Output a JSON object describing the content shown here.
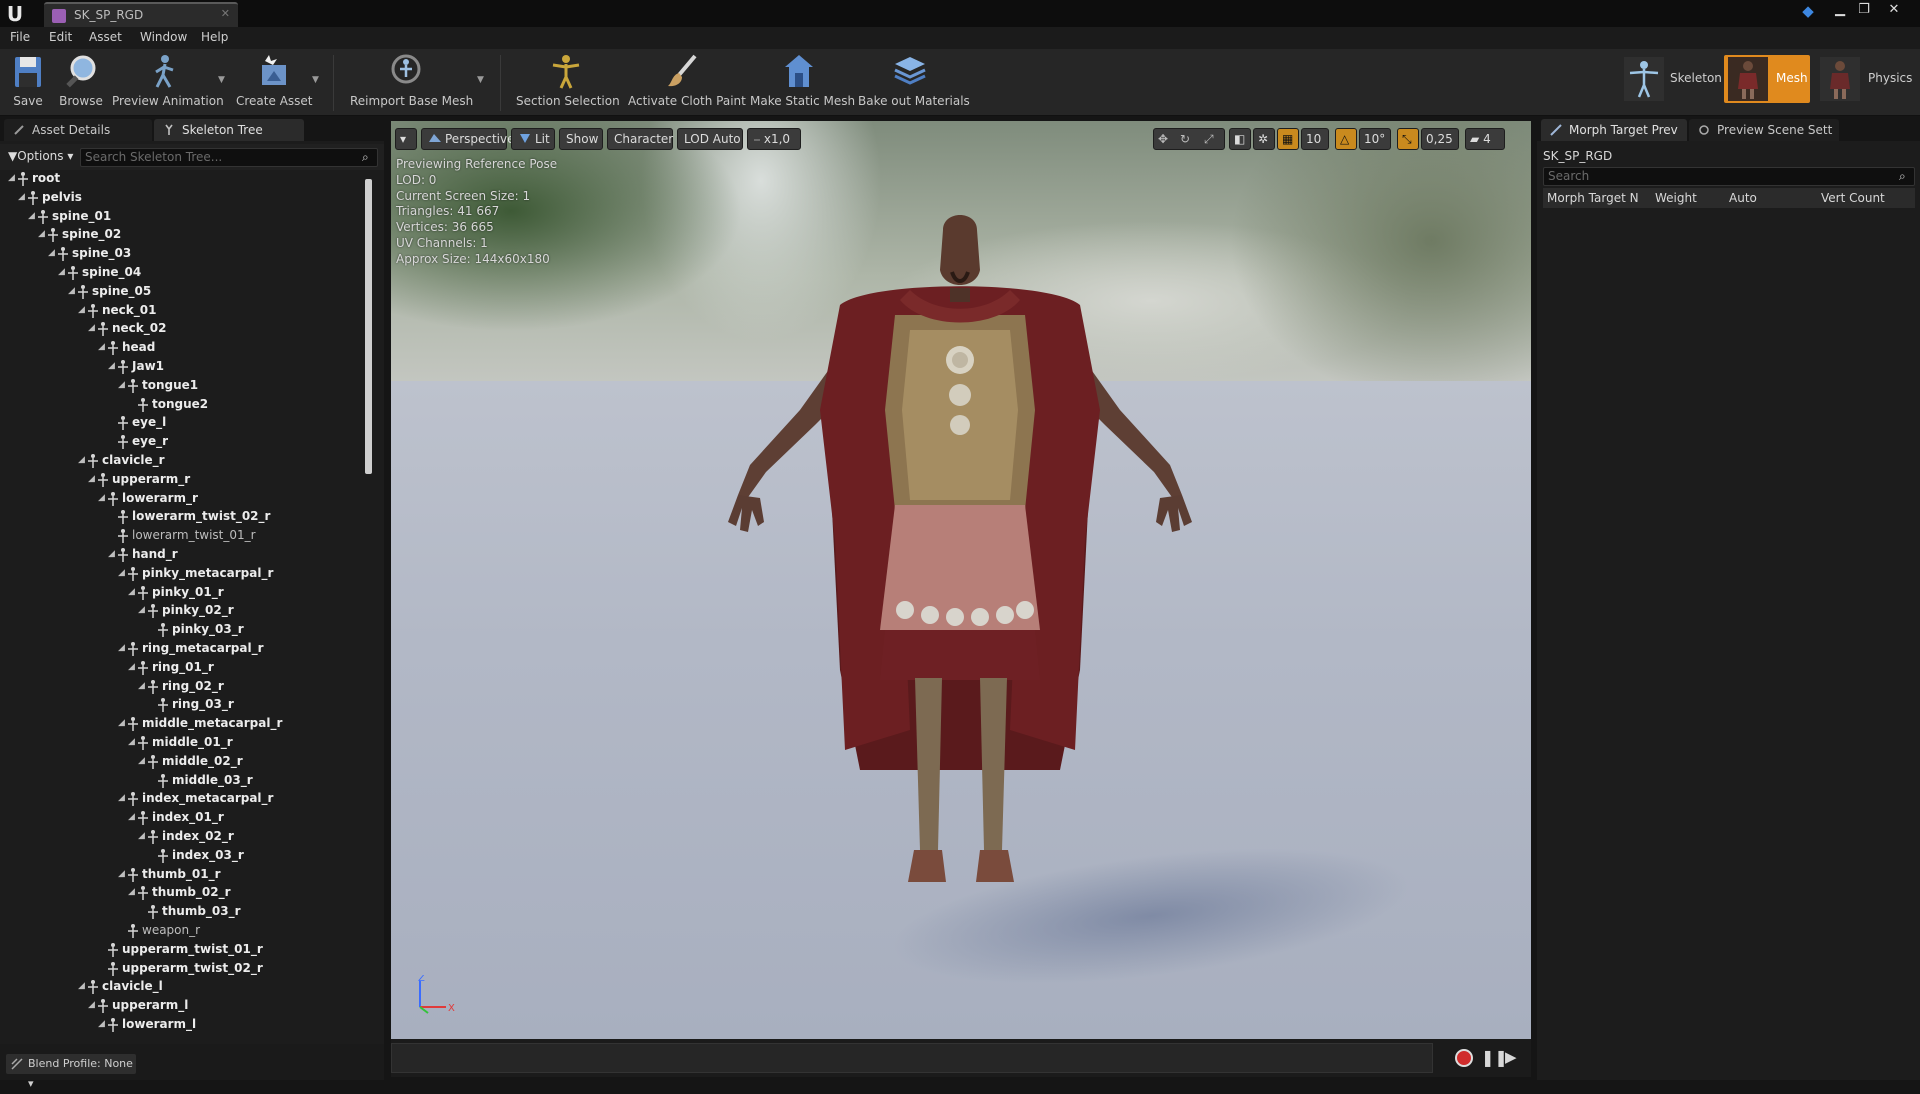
{
  "window": {
    "tab_title": "SK_SP_RGD",
    "controls": {
      "minimize": "▁",
      "restore": "❐",
      "close": "✕"
    }
  },
  "menu": [
    "File",
    "Edit",
    "Asset",
    "Window",
    "Help"
  ],
  "toolbar": {
    "save": "Save",
    "browse": "Browse",
    "preview_animation": "Preview Animation",
    "create_asset": "Create Asset",
    "reimport_base_mesh": "Reimport Base Mesh",
    "section_selection": "Section Selection",
    "activate_cloth_paint": "Activate Cloth Paint",
    "make_static_mesh": "Make Static Mesh",
    "bake_out_materials": "Bake out Materials"
  },
  "modes": {
    "skeleton": "Skeleton",
    "mesh": "Mesh",
    "physics": "Physics",
    "active": "Mesh"
  },
  "left_panel": {
    "tabs": [
      "Asset Details",
      "Skeleton Tree"
    ],
    "options_label": "Options",
    "search_placeholder": "Search Skeleton Tree...",
    "tree": [
      {
        "name": "root",
        "depth": 0,
        "bold": true,
        "expand": true
      },
      {
        "name": "pelvis",
        "depth": 1,
        "bold": true,
        "expand": true
      },
      {
        "name": "spine_01",
        "depth": 2,
        "bold": true,
        "expand": true
      },
      {
        "name": "spine_02",
        "depth": 3,
        "bold": true,
        "expand": true
      },
      {
        "name": "spine_03",
        "depth": 4,
        "bold": true,
        "expand": true
      },
      {
        "name": "spine_04",
        "depth": 5,
        "bold": true,
        "expand": true
      },
      {
        "name": "spine_05",
        "depth": 6,
        "bold": true,
        "expand": true
      },
      {
        "name": "neck_01",
        "depth": 7,
        "bold": true,
        "expand": true
      },
      {
        "name": "neck_02",
        "depth": 8,
        "bold": true,
        "expand": true
      },
      {
        "name": "head",
        "depth": 9,
        "bold": true,
        "expand": true
      },
      {
        "name": "Jaw1",
        "depth": 10,
        "bold": true,
        "expand": true
      },
      {
        "name": "tongue1",
        "depth": 11,
        "bold": true,
        "expand": true
      },
      {
        "name": "tongue2",
        "depth": 12,
        "bold": true,
        "expand": false
      },
      {
        "name": "eye_l",
        "depth": 10,
        "bold": true,
        "expand": false
      },
      {
        "name": "eye_r",
        "depth": 10,
        "bold": true,
        "expand": false
      },
      {
        "name": "clavicle_r",
        "depth": 7,
        "bold": true,
        "expand": true
      },
      {
        "name": "upperarm_r",
        "depth": 8,
        "bold": true,
        "expand": true
      },
      {
        "name": "lowerarm_r",
        "depth": 9,
        "bold": true,
        "expand": true
      },
      {
        "name": "lowerarm_twist_02_r",
        "depth": 10,
        "bold": true,
        "expand": false
      },
      {
        "name": "lowerarm_twist_01_r",
        "depth": 10,
        "bold": false,
        "expand": false
      },
      {
        "name": "hand_r",
        "depth": 10,
        "bold": true,
        "expand": true
      },
      {
        "name": "pinky_metacarpal_r",
        "depth": 11,
        "bold": true,
        "expand": true
      },
      {
        "name": "pinky_01_r",
        "depth": 12,
        "bold": true,
        "expand": true
      },
      {
        "name": "pinky_02_r",
        "depth": 13,
        "bold": true,
        "expand": true
      },
      {
        "name": "pinky_03_r",
        "depth": 14,
        "bold": true,
        "expand": false
      },
      {
        "name": "ring_metacarpal_r",
        "depth": 11,
        "bold": true,
        "expand": true
      },
      {
        "name": "ring_01_r",
        "depth": 12,
        "bold": true,
        "expand": true
      },
      {
        "name": "ring_02_r",
        "depth": 13,
        "bold": true,
        "expand": true
      },
      {
        "name": "ring_03_r",
        "depth": 14,
        "bold": true,
        "expand": false
      },
      {
        "name": "middle_metacarpal_r",
        "depth": 11,
        "bold": true,
        "expand": true
      },
      {
        "name": "middle_01_r",
        "depth": 12,
        "bold": true,
        "expand": true
      },
      {
        "name": "middle_02_r",
        "depth": 13,
        "bold": true,
        "expand": true
      },
      {
        "name": "middle_03_r",
        "depth": 14,
        "bold": true,
        "expand": false
      },
      {
        "name": "index_metacarpal_r",
        "depth": 11,
        "bold": true,
        "expand": true
      },
      {
        "name": "index_01_r",
        "depth": 12,
        "bold": true,
        "expand": true
      },
      {
        "name": "index_02_r",
        "depth": 13,
        "bold": true,
        "expand": true
      },
      {
        "name": "index_03_r",
        "depth": 14,
        "bold": true,
        "expand": false
      },
      {
        "name": "thumb_01_r",
        "depth": 11,
        "bold": true,
        "expand": true
      },
      {
        "name": "thumb_02_r",
        "depth": 12,
        "bold": true,
        "expand": true
      },
      {
        "name": "thumb_03_r",
        "depth": 13,
        "bold": true,
        "expand": false
      },
      {
        "name": "weapon_r",
        "depth": 11,
        "bold": false,
        "expand": false
      },
      {
        "name": "upperarm_twist_01_r",
        "depth": 9,
        "bold": true,
        "expand": false
      },
      {
        "name": "upperarm_twist_02_r",
        "depth": 9,
        "bold": true,
        "expand": false
      },
      {
        "name": "clavicle_l",
        "depth": 7,
        "bold": true,
        "expand": true
      },
      {
        "name": "upperarm_l",
        "depth": 8,
        "bold": true,
        "expand": true
      },
      {
        "name": "lowerarm_l",
        "depth": 9,
        "bold": true,
        "expand": true
      }
    ],
    "blend_profile": "Blend Profile: None"
  },
  "viewport": {
    "toolbar": {
      "perspective": "Perspective",
      "lit": "Lit",
      "show": "Show",
      "character": "Character",
      "lod": "LOD Auto",
      "speed": "x1,0",
      "grid_snap": "10",
      "rotation_snap": "10°",
      "scale_snap": "0,25",
      "camera_speed": "4"
    },
    "stats": [
      "Previewing Reference Pose",
      "LOD: 0",
      "Current Screen Size: 1",
      "Triangles: 41 667",
      "Vertices: 36 665",
      "UV Channels: 1",
      "Approx Size: 144x60x180"
    ],
    "axis": {
      "z": "Z",
      "x": "X"
    }
  },
  "right_panel": {
    "tabs": [
      "Morph Target Prev",
      "Preview Scene Sett"
    ],
    "asset_name": "SK_SP_RGD",
    "search_placeholder": "Search",
    "columns": [
      "Morph Target N",
      "Weight",
      "Auto",
      "Vert Count"
    ]
  },
  "colors": {
    "accent_orange": "#c98a1e",
    "active_mode": "#e08a1e",
    "record_red": "#d02c2c"
  }
}
